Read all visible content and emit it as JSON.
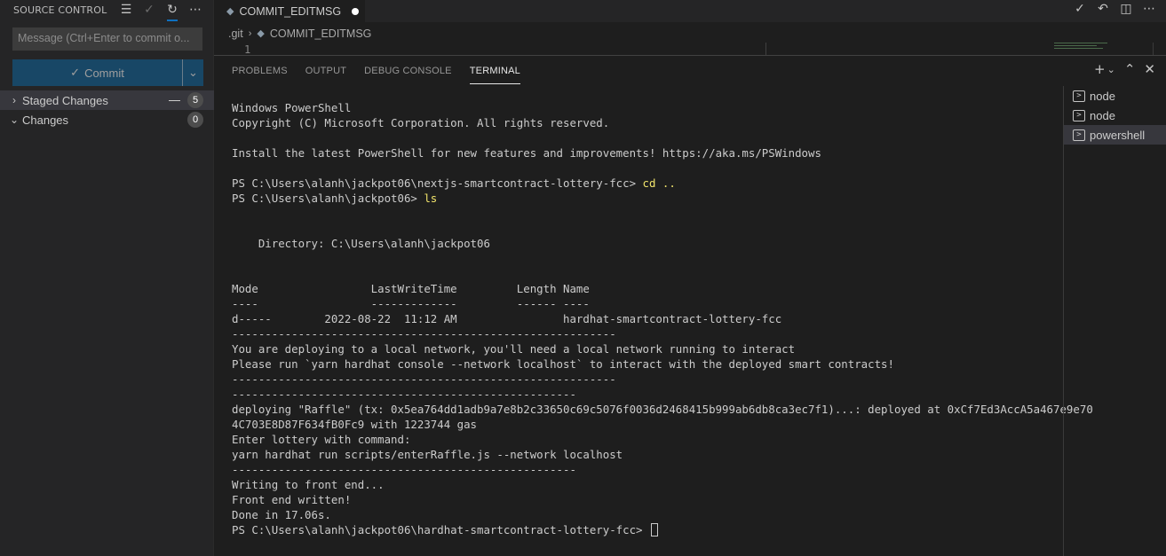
{
  "sidebar": {
    "title": "SOURCE CONTROL",
    "message_placeholder": "Message (Ctrl+Enter to commit o...",
    "commit_label": "Commit",
    "staged": {
      "label": "Staged Changes",
      "count": "5"
    },
    "changes": {
      "label": "Changes",
      "count": "0"
    }
  },
  "editor": {
    "tab_label": "COMMIT_EDITMSG",
    "breadcrumb": [
      ".git",
      "COMMIT_EDITMSG"
    ],
    "line_number": "1"
  },
  "panel": {
    "tabs": [
      "PROBLEMS",
      "OUTPUT",
      "DEBUG CONSOLE",
      "TERMINAL"
    ],
    "active_tab": "TERMINAL",
    "terminals": [
      "node",
      "node",
      "powershell"
    ],
    "selected_terminal": "powershell"
  },
  "terminal": {
    "lines": [
      "Windows PowerShell",
      "Copyright (C) Microsoft Corporation. All rights reserved.",
      "",
      "Install the latest PowerShell for new features and improvements! https://aka.ms/PSWindows",
      "",
      {
        "prompt": "PS C:\\Users\\alanh\\jackpot06\\nextjs-smartcontract-lottery-fcc> ",
        "cmd": "cd .."
      },
      {
        "prompt": "PS C:\\Users\\alanh\\jackpot06> ",
        "cmd": "ls"
      },
      "",
      "",
      "    Directory: C:\\Users\\alanh\\jackpot06",
      "",
      "",
      "Mode                 LastWriteTime         Length Name",
      "----                 -------------         ------ ----",
      "d-----        2022-08-22  11:12 AM                hardhat-smartcontract-lottery-fcc",
      "----------------------------------------------------------",
      "You are deploying to a local network, you'll need a local network running to interact",
      "Please run `yarn hardhat console --network localhost` to interact with the deployed smart contracts!",
      "----------------------------------------------------------",
      "----------------------------------------------------",
      "deploying \"Raffle\" (tx: 0x5ea764dd1adb9a7e8b2c33650c69c5076f0036d2468415b999ab6db8ca3ec7f1)...: deployed at 0xCf7Ed3AccA5a467e9e70",
      "4C703E8D87F634fB0Fc9 with 1223744 gas",
      "Enter lottery with command:",
      "yarn hardhat run scripts/enterRaffle.js --network localhost",
      "----------------------------------------------------",
      "Writing to front end...",
      "Front end written!",
      "Done in 17.06s.",
      {
        "prompt": "PS C:\\Users\\alanh\\jackpot06\\hardhat-smartcontract-lottery-fcc> ",
        "cmd": "",
        "cursor": true
      }
    ]
  }
}
